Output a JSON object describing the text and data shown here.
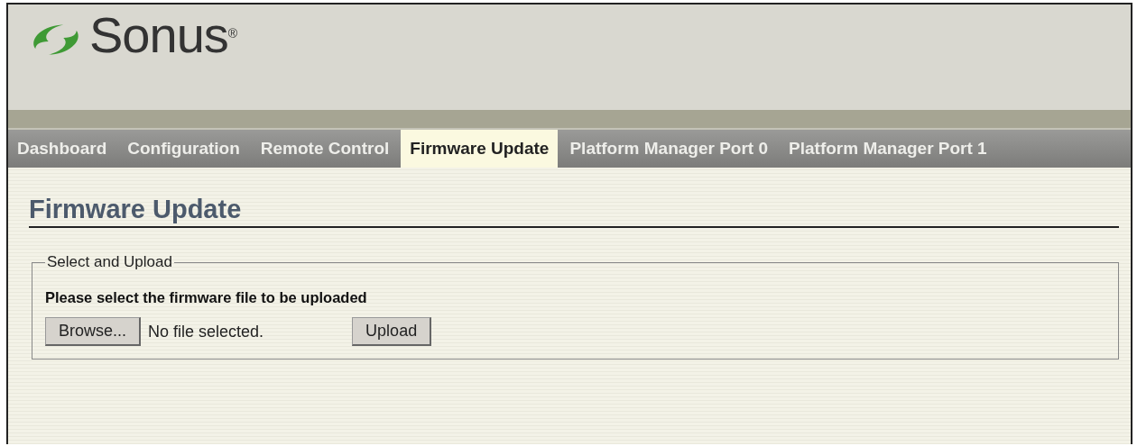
{
  "header": {
    "logo_text": "Sonus$^{®}$"
  },
  "tabs": [
    {
      "label": "Dashboard",
      "selected": false
    },
    {
      "label": "Configuration",
      "selected": false
    },
    {
      "label": "Remote Control",
      "selected": false
    },
    {
      "label": "Firmware Update",
      "selected": true
    },
    {
      "label": "Platform Manager Port 0",
      "selected": false
    },
    {
      "label": "Platform Manager Port 1",
      "selected": false
    }
  ],
  "page_title": "Firmware Update",
  "fieldset": {
    "legend": "Select and Upload",
    "instruction": "Please select the firmware file to be uploaded",
    "browse_button": "Browse...",
    "file_status": "No file selected.",
    "upload_button": "Upload"
  }
}
